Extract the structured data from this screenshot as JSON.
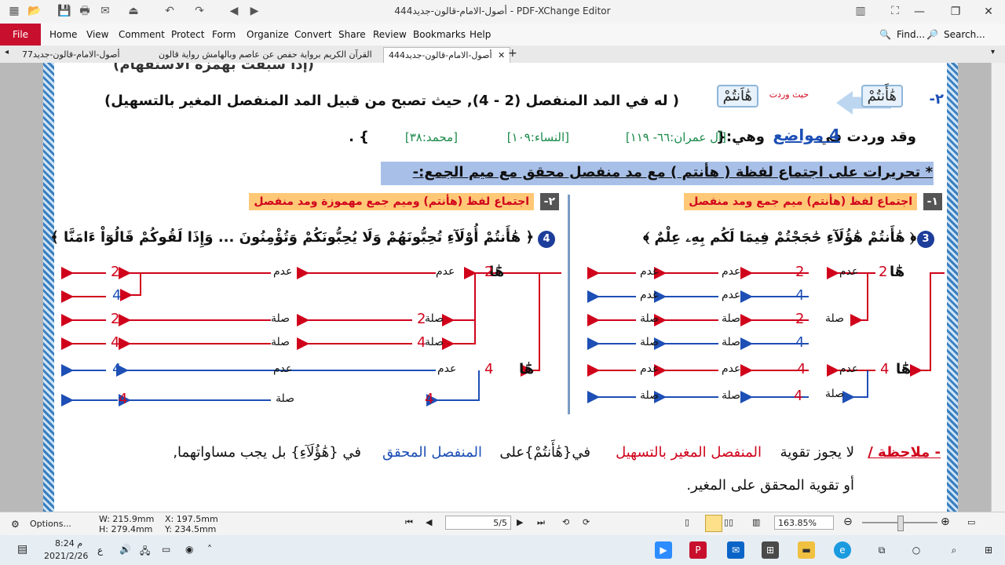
{
  "window": {
    "title": "44أصول-الامام-قالون-جديد4 - PDF-XChange Editor"
  },
  "menu": {
    "file": "File",
    "items": [
      "Home",
      "View",
      "Comment",
      "Protect",
      "Form",
      "Organize",
      "Convert",
      "Share",
      "Review",
      "Bookmarks",
      "Help"
    ],
    "find": "Find...",
    "search": "Search..."
  },
  "tabs": [
    {
      "label": "أصول-الامام-قالون-جديد77"
    },
    {
      "label": "القرآن الكريم برواية حفص عن عاصم وبالهامش رواية قالون"
    },
    {
      "label": "44أصول-الامام-قالون-جديد4"
    }
  ],
  "document": {
    "top_fragment": "(إذا سبقت بهمزة الاستفهام)",
    "row2_num": "٢-",
    "word_boxed_1": "هَٰأَنتُمْ",
    "word_boxed_2": "هَٰاَنتُمْ",
    "where_found": "حيث وردت",
    "row2_text": "( له في المد المنفصل (2 - 4), حيث تصبح من قبيل المد المنفصل المغير بالتسهيل)",
    "row3_prefix": "وقد وردت في",
    "row3_count": "4 مواضع",
    "row3_suffix": "وهي:{",
    "ref1": "[آل عمران:٦٦- ١١٩]",
    "ref2": "[النساء:١٠٩]",
    "ref3": "[محمد:٣٨]",
    "row3_end": "} .",
    "section_title": "* تحريرات على اجتماع لفظة ( هأنتم ) مع مد منفصل محقق مع ميم الجمع:-",
    "right_num": "١-",
    "right_header": "اجتماع لفظ (هأنتم) ميم جمع ومد منفصل",
    "left_num": "٢-",
    "left_header": "اجتماع لفظ (هأنتم) وميم جمع مهموزة ومد منفصل",
    "right_badge": "3",
    "left_badge": "4",
    "right_verse": "﴿ هَٰأَنتُمْ هَٰؤُلَآءِ حَٰجَجْتُمْ فِيمَا لَكُم بِهِۦ عِلْمٌ ﴾",
    "left_verse": "﴿ هَٰأَنتُمْ أُوْلَآءِ تُحِبُّونَهُمْ وَلَا يُحِبُّونَكُمْ وَتُؤْمِنُونَ ... وَإِذَا لَقُوكُمْ قَالُوٓاْ ءَامَنَّا ﴾",
    "ha": "هَٰٓا",
    "adam": "عدم",
    "sila": "صلة",
    "n2": "2",
    "n4": "4",
    "note_label": "- ملاحظة /",
    "note_text1": "لا يجوز تقوية",
    "note_red": "المنفصل المغير بالتسهيل",
    "note_text2": "في{هَٰأَنتُمْ}على",
    "note_blue": "المنفصل المحقق",
    "note_text3": "في {هَٰؤُلَآءِ} بل يجب مساواتهما,",
    "note_line2": "أو تقوية المحقق على المغير."
  },
  "status": {
    "options": "Options...",
    "width": "W: 215.9mm",
    "height": "H: 279.4mm",
    "x": "X: 197.5mm",
    "y": "Y: 234.5mm",
    "page": "5/5",
    "zoom": "163.85%"
  },
  "taskbar": {
    "time": "8:24 م",
    "date": "2021/2/26",
    "lang": "ع"
  },
  "colors": {
    "accent": "#c8102e",
    "red": "#d0021b",
    "blue": "#1d4fb5"
  }
}
